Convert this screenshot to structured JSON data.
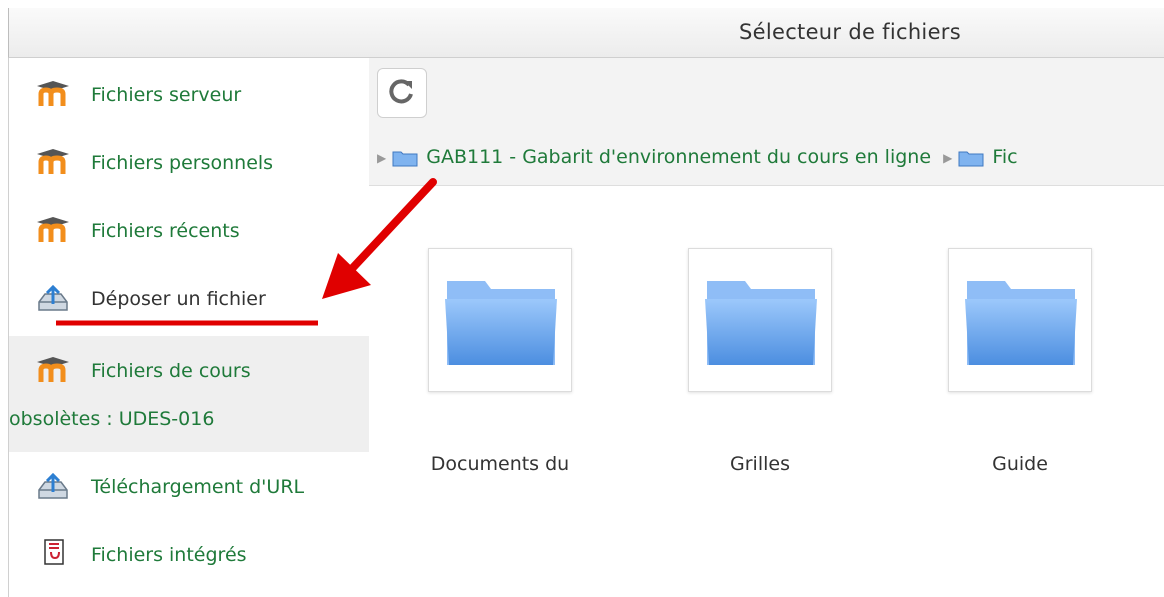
{
  "window": {
    "title": "Sélecteur de fichiers"
  },
  "sidebar": {
    "items": [
      {
        "label": "Fichiers serveur",
        "icon": "moodle-icon"
      },
      {
        "label": "Fichiers personnels",
        "icon": "moodle-icon"
      },
      {
        "label": "Fichiers récents",
        "icon": "moodle-icon"
      },
      {
        "label": "Déposer un fichier",
        "icon": "upload-icon"
      },
      {
        "label": "Fichiers de cours",
        "label2": "obsolètes : UDES-016",
        "icon": "moodle-icon",
        "active": true
      },
      {
        "label": "Téléchargement d'URL",
        "icon": "upload-icon"
      },
      {
        "label": "Fichiers intégrés",
        "icon": "embedded-files-icon"
      }
    ]
  },
  "toolbar": {
    "refresh_icon": "refresh-icon"
  },
  "breadcrumb": {
    "items": [
      "GAB111 - Gabarit d'environnement du cours en ligne",
      "Fic"
    ]
  },
  "files": [
    {
      "name": "Documents du",
      "icon": "folder-icon"
    },
    {
      "name": "Grilles",
      "icon": "folder-icon"
    },
    {
      "name": "Guide",
      "icon": "folder-icon"
    }
  ],
  "colors": {
    "link": "#1f7a3a",
    "annotation": "#e00000",
    "folder": "#6aa0e6"
  }
}
